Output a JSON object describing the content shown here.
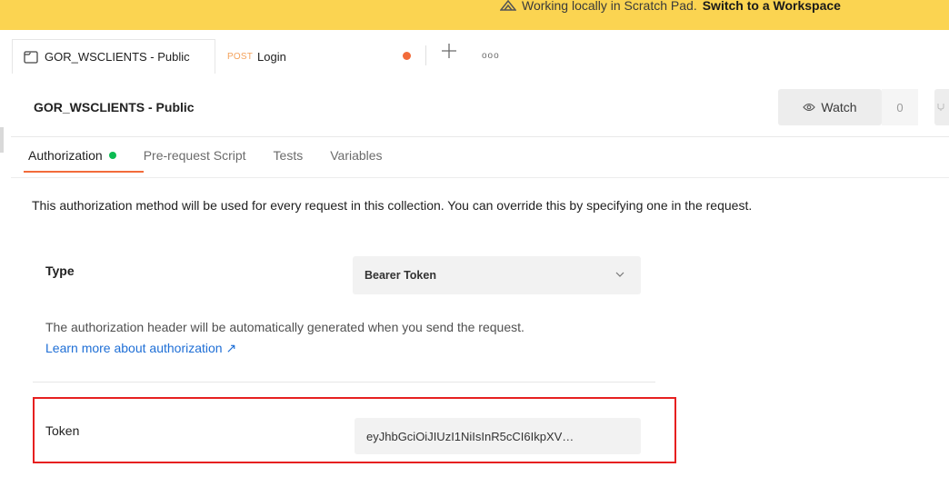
{
  "banner": {
    "text": "Working locally in Scratch Pad.",
    "link": "Switch to a Workspace",
    "icon": "scratchpad-icon"
  },
  "tabs": [
    {
      "label": "GOR_WSCLIENTS - Public",
      "icon": "collection-icon"
    },
    {
      "method": "POST",
      "label": "Login",
      "method_color": "#f4a25b"
    }
  ],
  "tabbar": {
    "more_label": "ooo"
  },
  "header": {
    "title": "GOR_WSCLIENTS - Public",
    "watch_label": "Watch",
    "watch_count": "0"
  },
  "subtabs": [
    {
      "label": "Authorization",
      "active": true
    },
    {
      "label": "Pre-request Script"
    },
    {
      "label": "Tests"
    },
    {
      "label": "Variables"
    }
  ],
  "auth": {
    "description": "This authorization method will be used for every request in this collection. You can override this by specifying one in the request.",
    "type_label": "Type",
    "type_value": "Bearer Token",
    "help_text": "The authorization header will be automatically generated when you send the request.",
    "learn_more": "Learn more about authorization ↗",
    "token_label": "Token",
    "token_value": "eyJhbGciOiJIUzI1NiIsInR5cCI6IkpXV…"
  },
  "colors": {
    "banner": "#fbd451",
    "accent": "#f26b3a",
    "status_dot": "#0cbb52",
    "link": "#1f6fd6",
    "highlight": "#e62020"
  }
}
